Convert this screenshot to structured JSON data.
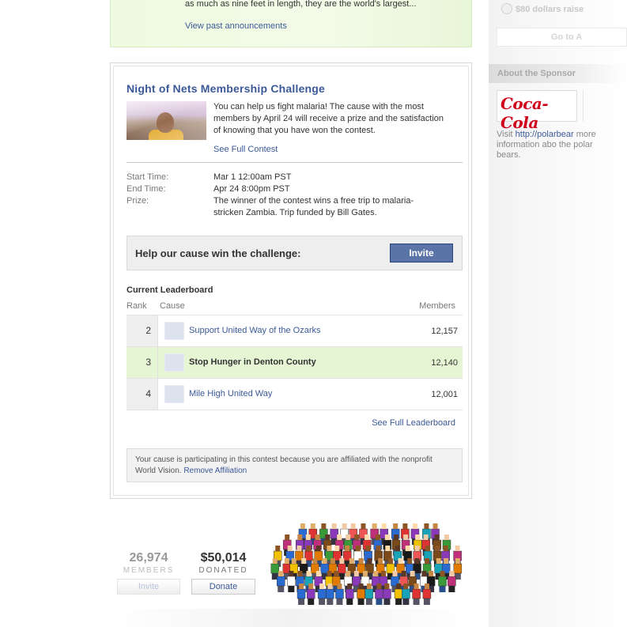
{
  "announcement": {
    "text": "as much as nine feet in length, they are the world's largest...",
    "past_link": "View past announcements"
  },
  "sidebar": {
    "raised_text": "$80 dollars raise",
    "goto_label": "Go to A",
    "about_title": "About the Sponsor",
    "sponsor_logo_text": "Coca-Cola",
    "visit_prefix": "Visit ",
    "visit_link": "http://polarbear",
    "visit_suffix": " more information abo the polar bears."
  },
  "contest": {
    "title": "Night of Nets Membership Challenge",
    "description": "You can help us fight malaria! The cause with the most members by April 24 will receive a prize and the satisfaction of knowing that you have won the contest.",
    "see_full_contest": "See Full Contest",
    "start_label": "Start Time:",
    "start_value": "Mar 1 12:00am PST",
    "end_label": "End Time:",
    "end_value": "Apr 24 8:00pm PST",
    "prize_label": "Prize:",
    "prize_value": "The winner of the contest wins a free trip to malaria-stricken Zambia. Trip funded by Bill Gates.",
    "help_label": "Help our cause win the challenge:",
    "invite_label": "Invite"
  },
  "leaderboard": {
    "title": "Current Leaderboard",
    "col_rank": "Rank",
    "col_cause": "Cause",
    "col_members": "Members",
    "rows": [
      {
        "rank": "2",
        "cause": "Support United Way of the Ozarks",
        "members": "12,157",
        "current": false
      },
      {
        "rank": "3",
        "cause": "Stop Hunger in Denton County",
        "members": "12,140",
        "current": true
      },
      {
        "rank": "4",
        "cause": "Mile High United Way",
        "members": "12,001",
        "current": false
      }
    ],
    "see_full": "See Full Leaderboard"
  },
  "affiliation": {
    "text": "Your cause is participating in this contest because you are affiliated with the nonprofit World Vision.",
    "remove_link": "Remove Affiliation"
  },
  "stats": {
    "members_count": "26,974",
    "members_label": "MEMBERS",
    "members_button": "Invite",
    "donated_amount": "$50,014",
    "donated_label": "DONATED",
    "donate_button": "Donate"
  }
}
